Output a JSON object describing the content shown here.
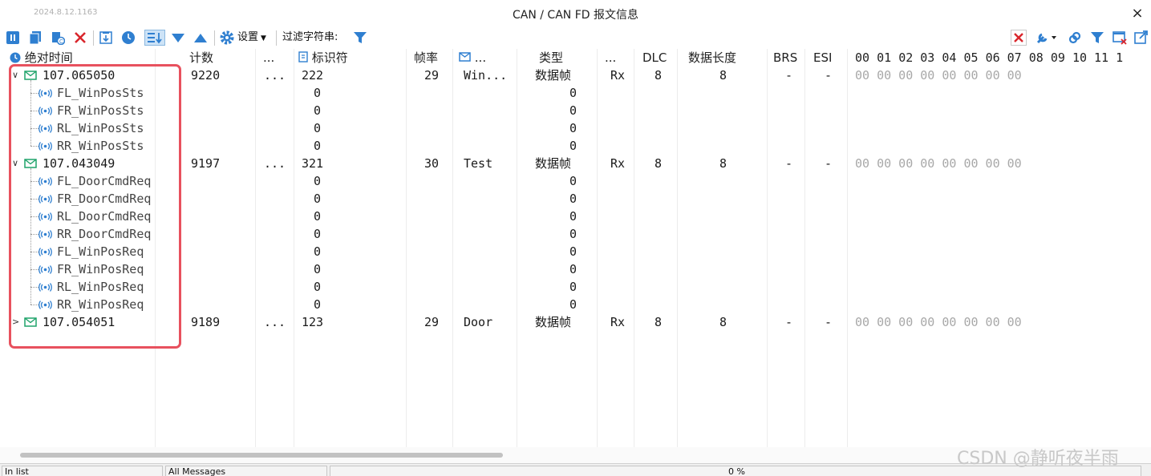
{
  "window": {
    "version": "2024.8.12.1163",
    "title": "CAN / CAN FD 报文信息",
    "close": "×"
  },
  "toolbar": {
    "settings_label": "设置",
    "filter_label": "过滤字符串:"
  },
  "columns": {
    "abs_time": "绝对时间",
    "count": "计数",
    "more1": "...",
    "identifier": "标识符",
    "frame_rate": "帧率",
    "name": "...",
    "type": "类型",
    "more2": "...",
    "dlc": "DLC",
    "data_length": "数据长度",
    "brs": "BRS",
    "esi": "ESI",
    "bytes": [
      "00",
      "01",
      "02",
      "03",
      "04",
      "05",
      "06",
      "07",
      "08",
      "09",
      "10",
      "11",
      "1"
    ]
  },
  "rows": [
    {
      "kind": "msg",
      "expander": "∨",
      "time": "107.065050",
      "count": "9220",
      "more": "...",
      "id": "222",
      "rate": "29",
      "name": "Win...",
      "type": "数据帧",
      "dir": "Rx",
      "dlc": "8",
      "len": "8",
      "brs": "-",
      "esi": "-",
      "data": "00 00 00 00 00 00 00 00"
    },
    {
      "kind": "sig",
      "name": "FL_WinPosSts",
      "id": "0",
      "type": "0"
    },
    {
      "kind": "sig",
      "name": "FR_WinPosSts",
      "id": "0",
      "type": "0"
    },
    {
      "kind": "sig",
      "name": "RL_WinPosSts",
      "id": "0",
      "type": "0"
    },
    {
      "kind": "sig",
      "name": "RR_WinPosSts",
      "id": "0",
      "type": "0"
    },
    {
      "kind": "msg",
      "expander": "∨",
      "time": "107.043049",
      "count": "9197",
      "more": "...",
      "id": "321",
      "rate": "30",
      "name": "Test",
      "type": "数据帧",
      "dir": "Rx",
      "dlc": "8",
      "len": "8",
      "brs": "-",
      "esi": "-",
      "data": "00 00 00 00 00 00 00 00"
    },
    {
      "kind": "sig",
      "name": "FL_DoorCmdReq",
      "id": "0",
      "type": "0"
    },
    {
      "kind": "sig",
      "name": "FR_DoorCmdReq",
      "id": "0",
      "type": "0"
    },
    {
      "kind": "sig",
      "name": "RL_DoorCmdReq",
      "id": "0",
      "type": "0"
    },
    {
      "kind": "sig",
      "name": "RR_DoorCmdReq",
      "id": "0",
      "type": "0"
    },
    {
      "kind": "sig",
      "name": "FL_WinPosReq",
      "id": "0",
      "type": "0"
    },
    {
      "kind": "sig",
      "name": "FR_WinPosReq",
      "id": "0",
      "type": "0"
    },
    {
      "kind": "sig",
      "name": "RL_WinPosReq",
      "id": "0",
      "type": "0"
    },
    {
      "kind": "sig",
      "name": "RR_WinPosReq",
      "id": "0",
      "type": "0"
    },
    {
      "kind": "msg",
      "expander": ">",
      "time": "107.054051",
      "count": "9189",
      "more": "...",
      "id": "123",
      "rate": "29",
      "name": "Door",
      "type": "数据帧",
      "dir": "Rx",
      "dlc": "8",
      "len": "8",
      "brs": "-",
      "esi": "-",
      "data": "00 00 00 00 00 00 00 00"
    }
  ],
  "status": {
    "in_list": "In list",
    "all_messages": "All Messages",
    "percent": "0 %"
  },
  "watermark": "CSDN @静听夜半雨",
  "colors": {
    "accent_blue": "#2f7fd0",
    "msg_icon_green": "#1fa36a",
    "delete_red": "#d9262c",
    "highlight_red": "#e8515e"
  }
}
